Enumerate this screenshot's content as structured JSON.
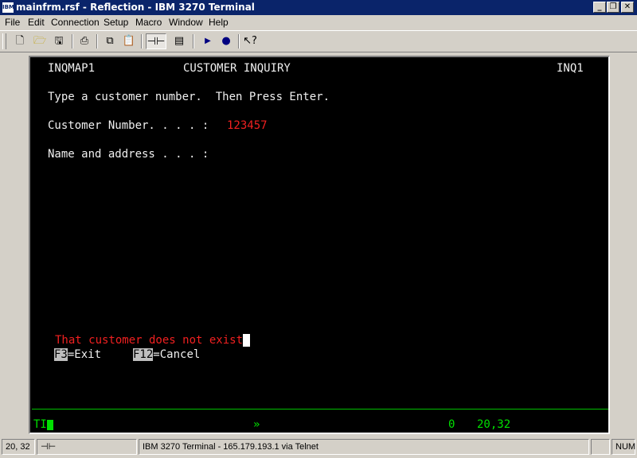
{
  "window": {
    "app_icon": "IBM",
    "title": "mainfrm.rsf - Reflection - IBM 3270 Terminal",
    "minimize_icon": "minimize-icon",
    "restore_icon": "restore-icon",
    "close_icon": "close-icon"
  },
  "menu": {
    "items": [
      "File",
      "Edit",
      "Connection",
      "Setup",
      "Macro",
      "Window",
      "Help"
    ]
  },
  "toolbar": {
    "buttons": [
      "new-icon",
      "open-icon",
      "save-icon",
      "print-icon",
      "copy-icon",
      "paste-icon",
      "connect-icon",
      "settings-icon",
      "play-icon",
      "record-icon",
      "help-icon"
    ]
  },
  "screen": {
    "map_name": "INQMAP1",
    "title": "CUSTOMER INQUIRY",
    "trans_id": "INQ1",
    "instruction": "Type a customer number.  Then Press Enter.",
    "customer_label": "Customer Number. . . . :",
    "customer_value": "123457",
    "address_label": "Name and address . . . :",
    "message": "That customer does not exist",
    "fkeys": [
      {
        "key": "F3",
        "label": "=Exit"
      },
      {
        "key": "F12",
        "label": "=Cancel"
      }
    ],
    "colors": {
      "background": "#000000",
      "text": "#f0f0f0",
      "error": "#f02020",
      "oia": "#00e000"
    }
  },
  "oia": {
    "left": "TI",
    "indicator": "»",
    "count": "0",
    "cursor_pos": "20,32"
  },
  "status": {
    "position": "20, 32",
    "connection": "IBM 3270 Terminal - 165.179.193.1 via Telnet",
    "num": "NUM"
  }
}
